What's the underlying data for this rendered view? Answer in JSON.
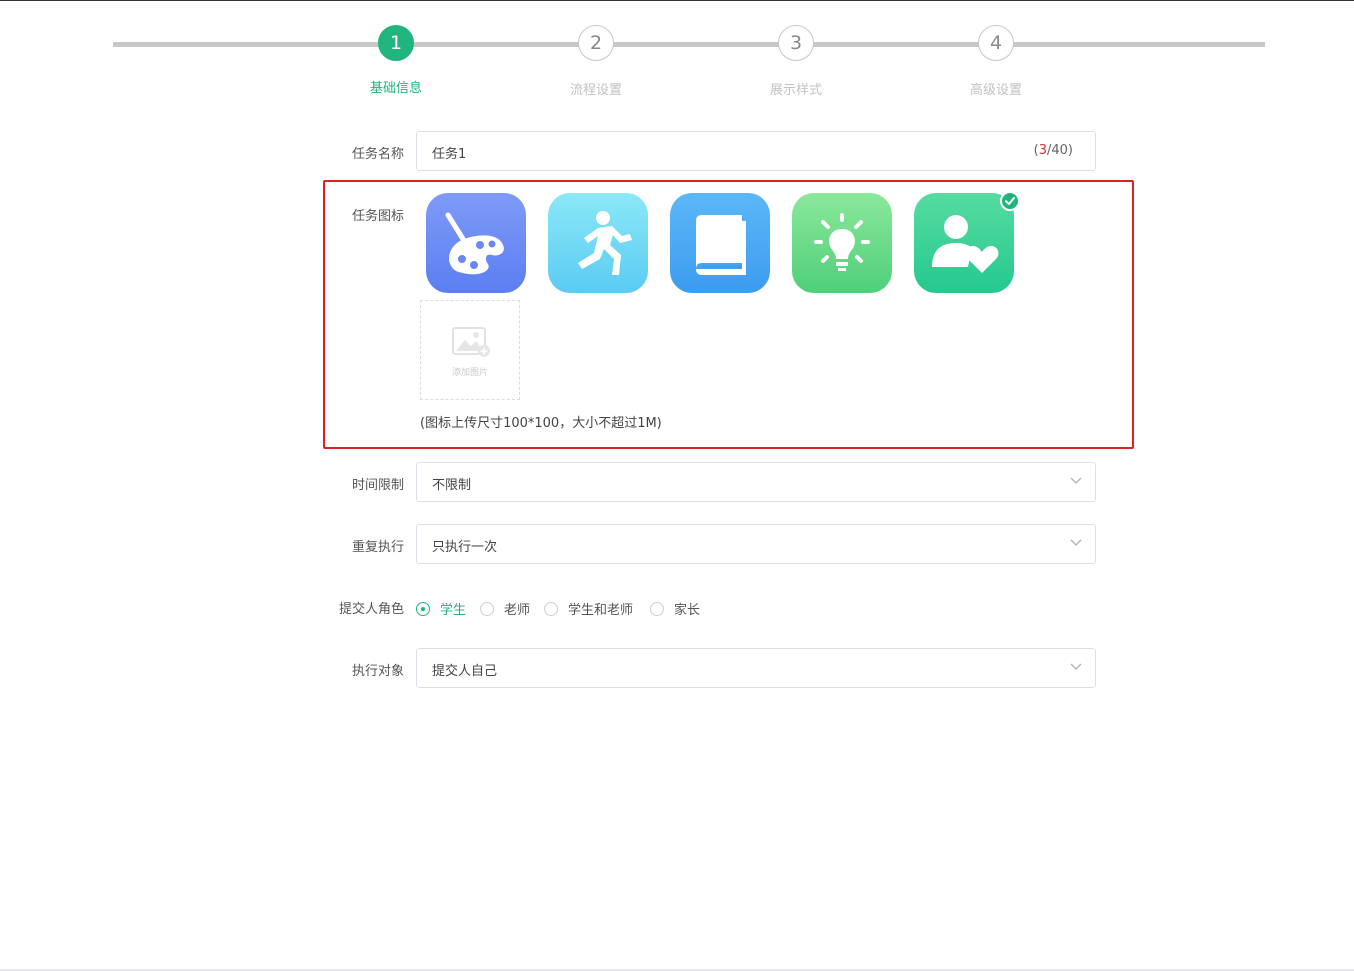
{
  "steps": [
    {
      "num": "1",
      "label": "基础信息",
      "active": true
    },
    {
      "num": "2",
      "label": "流程设置",
      "active": false
    },
    {
      "num": "3",
      "label": "展示样式",
      "active": false
    },
    {
      "num": "4",
      "label": "高级设置",
      "active": false
    }
  ],
  "task_name": {
    "label": "任务名称",
    "value": "任务1",
    "counter_open": "(",
    "counter_current": "3",
    "counter_rest": "/40)"
  },
  "task_icon": {
    "label": "任务图标",
    "icons": [
      "palette-icon",
      "running-person-icon",
      "book-icon",
      "lightbulb-icon",
      "person-heart-icon"
    ],
    "selected": "person-heart-icon",
    "upload_label": "添加图片",
    "hint": "(图标上传尺寸100*100，大小不超过1M)"
  },
  "time_limit": {
    "label": "时间限制",
    "value": "不限制"
  },
  "repeat": {
    "label": "重复执行",
    "value": "只执行一次"
  },
  "submitter_role": {
    "label": "提交人角色",
    "options": [
      "学生",
      "老师",
      "学生和老师",
      "家长"
    ],
    "selected": "学生"
  },
  "target": {
    "label": "执行对象",
    "value": "提交人自己"
  },
  "colors": {
    "accent": "#20b57c",
    "highlight": "#e02020"
  }
}
